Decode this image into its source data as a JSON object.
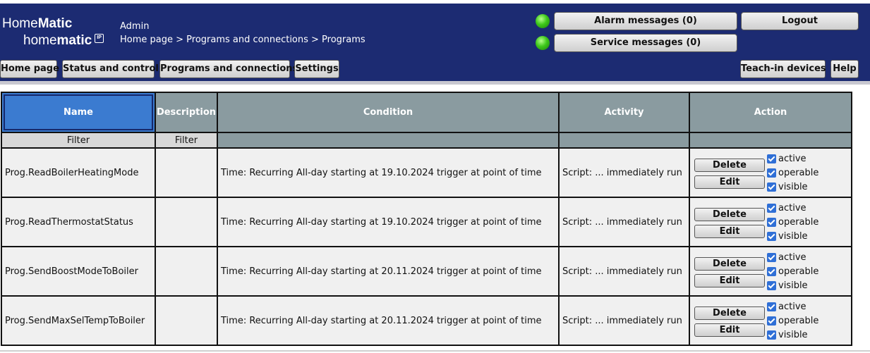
{
  "logo": {
    "top_light": "Home",
    "top_bold": "Matic",
    "bot_light": "home",
    "bot_bold": "matic",
    "badge": "IP"
  },
  "user": "Admin",
  "breadcrumb": "Home page > Programs and connections > Programs",
  "header_buttons": {
    "alarm": "Alarm messages (0)",
    "service": "Service messages (0)",
    "logout": "Logout",
    "teach_in": "Teach-in devices",
    "help": "Help"
  },
  "nav": {
    "home": "Home page",
    "status": "Status and control",
    "programs": "Programs and connections",
    "settings": "Settings"
  },
  "table": {
    "headers": {
      "name": "Name",
      "description": "Description",
      "condition": "Condition",
      "activity": "Activity",
      "action": "Action"
    },
    "filter_label": "Filter",
    "delete_label": "Delete",
    "edit_label": "Edit",
    "flags": {
      "active": "active",
      "operable": "operable",
      "visible": "visible"
    },
    "rows": [
      {
        "name": "Prog.ReadBoilerHeatingMode",
        "description": "",
        "condition": "Time: Recurring All-day starting at 19.10.2024 trigger at point of time",
        "activity": "Script: ... immediately run"
      },
      {
        "name": "Prog.ReadThermostatStatus",
        "description": "",
        "condition": "Time: Recurring All-day starting at 19.10.2024 trigger at point of time",
        "activity": "Script: ... immediately run"
      },
      {
        "name": "Prog.SendBoostModeToBoiler",
        "description": "",
        "condition": "Time: Recurring All-day starting at 20.11.2024 trigger at point of time",
        "activity": "Script: ... immediately run"
      },
      {
        "name": "Prog.SendMaxSelTempToBoiler",
        "description": "",
        "condition": "Time: Recurring All-day starting at 20.11.2024 trigger at point of time",
        "activity": "Script: ... immediately run"
      }
    ]
  },
  "colors": {
    "header_bg": "#1c2b72",
    "name_header": "#3b7bd0",
    "header_gray": "#8a9ba0",
    "led_green": "#3ec81b",
    "checkbox": "#2f6fd6"
  }
}
